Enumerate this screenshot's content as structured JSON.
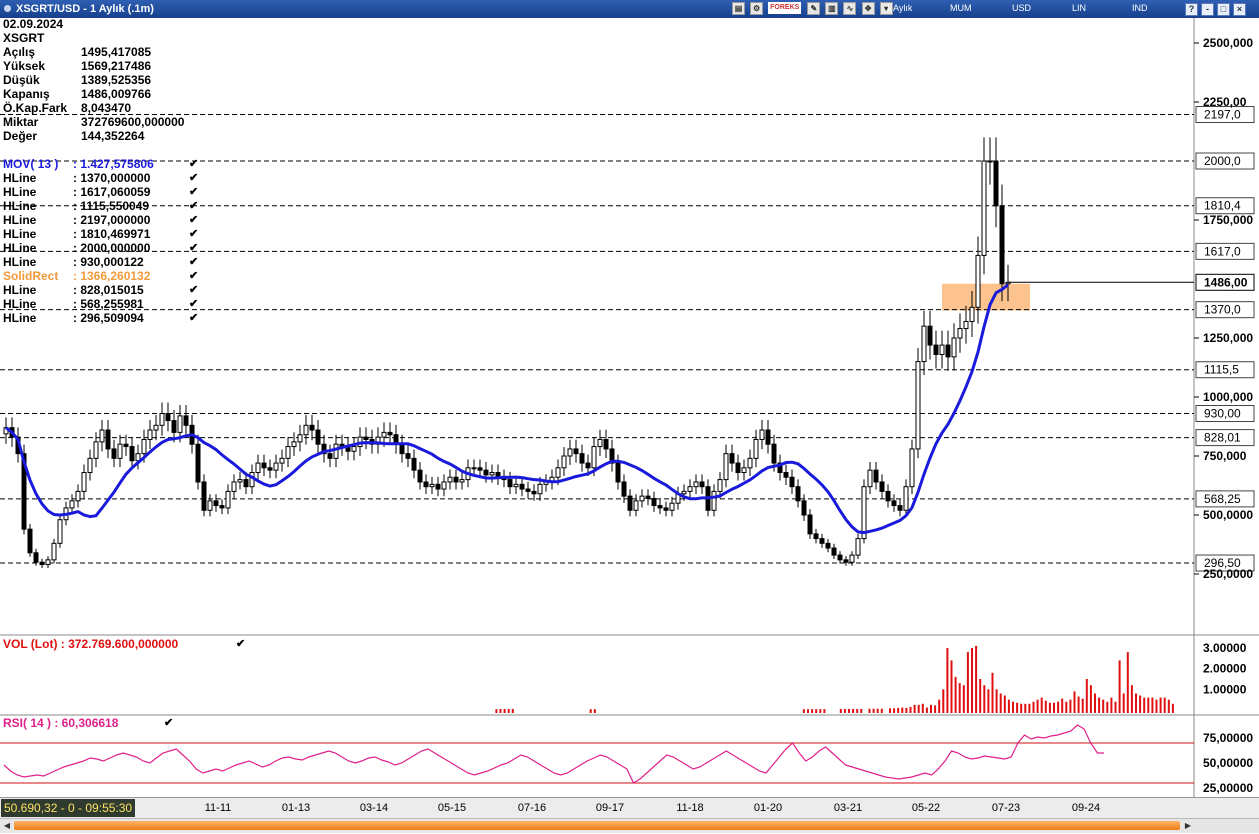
{
  "window": {
    "title": "XSGRT/USD - 1 Aylık (.1m)",
    "brand": "FOREKS",
    "options": [
      "1 Aylık",
      "MUM",
      "USD",
      "LIN",
      "IND"
    ],
    "controls": [
      "?",
      "-",
      "□",
      "×"
    ]
  },
  "info": {
    "date": "02.09.2024",
    "symbol": "XSGRT",
    "rows": [
      {
        "label": "Açılış",
        "value": "1495,417085"
      },
      {
        "label": "Yüksek",
        "value": "1569,217486"
      },
      {
        "label": "Düşük",
        "value": "1389,525356"
      },
      {
        "label": "Kapanış",
        "value": "1486,009766"
      },
      {
        "label": "Ö.Kap.Fark",
        "value": "8,043470"
      },
      {
        "label": "Miktar",
        "value": "372769600,000000"
      },
      {
        "label": "Değer",
        "value": "144,352264"
      }
    ]
  },
  "indicators": [
    {
      "name": "MOV( 13 )",
      "value": ": 1.427,575806",
      "color": "#1a1adc"
    },
    {
      "name": "HLine",
      "value": ": 1370,000000",
      "color": "#000000"
    },
    {
      "name": "HLine",
      "value": ": 1617,060059",
      "color": "#000000"
    },
    {
      "name": "HLine",
      "value": ": 1115,550049",
      "color": "#000000"
    },
    {
      "name": "HLine",
      "value": ": 2197,000000",
      "color": "#000000"
    },
    {
      "name": "HLine",
      "value": ": 1810,469971",
      "color": "#000000"
    },
    {
      "name": "HLine",
      "value": ": 2000,000000",
      "color": "#000000"
    },
    {
      "name": "HLine",
      "value": ": 930,000122",
      "color": "#000000"
    },
    {
      "name": "SolidRect",
      "value": ": 1366,260132",
      "color": "#f39a3a"
    },
    {
      "name": "HLine",
      "value": ": 828,015015",
      "color": "#000000"
    },
    {
      "name": "HLine",
      "value": ": 568,255981",
      "color": "#000000"
    },
    {
      "name": "HLine",
      "value": ": 296,509094",
      "color": "#000000"
    }
  ],
  "volume_label": "VOL (Lot)   : 372.769.600,000000",
  "rsi_label": "RSI( 14 )   : 60,306618",
  "status": {
    "clock": "50.690,32 - 0 - 09:55:30",
    "x_ticks": [
      "11-11",
      "01-13",
      "03-14",
      "05-15",
      "07-16",
      "09-17",
      "11-18",
      "01-20",
      "03-21",
      "05-22",
      "07-23",
      "09-24"
    ]
  },
  "chart_data": {
    "type": "candlestick",
    "price_axis": {
      "ticks": [
        "2500,000",
        "2250,00",
        "1750,000",
        "1250,000",
        "1000,000",
        "750,000",
        "500,0000",
        "250,0000"
      ],
      "tick_values": [
        2500,
        2250,
        1750,
        1250,
        1000,
        750,
        500,
        250
      ]
    },
    "hlines": [
      {
        "value": 2197.0,
        "label": "2197,0"
      },
      {
        "value": 2000.0,
        "label": "2000,0"
      },
      {
        "value": 1810.47,
        "label": "1810,4"
      },
      {
        "value": 1617.06,
        "label": "1617,0"
      },
      {
        "value": 1370.0,
        "label": "1370,0"
      },
      {
        "value": 1115.55,
        "label": "1115,5"
      },
      {
        "value": 930.0,
        "label": "930,00"
      },
      {
        "value": 828.02,
        "label": "828,01"
      },
      {
        "value": 568.26,
        "label": "568,25"
      },
      {
        "value": 296.51,
        "label": "296,50"
      }
    ],
    "last_price": {
      "value": 1486.01,
      "label": "1486,00"
    },
    "solid_rect": {
      "low": 1366.26,
      "high": 1480,
      "color": "#fbb97a"
    },
    "closes": [
      870,
      830,
      760,
      440,
      340,
      300,
      290,
      310,
      380,
      480,
      530,
      560,
      600,
      680,
      740,
      810,
      860,
      780,
      740,
      800,
      790,
      730,
      760,
      820,
      860,
      880,
      930,
      900,
      850,
      920,
      880,
      800,
      640,
      520,
      560,
      540,
      530,
      600,
      640,
      650,
      620,
      680,
      720,
      700,
      690,
      720,
      740,
      790,
      810,
      840,
      880,
      860,
      800,
      760,
      740,
      800,
      790,
      770,
      790,
      830,
      820,
      800,
      830,
      850,
      840,
      800,
      760,
      740,
      690,
      640,
      620,
      630,
      610,
      640,
      660,
      640,
      650,
      700,
      700,
      690,
      670,
      680,
      660,
      650,
      620,
      630,
      610,
      600,
      590,
      630,
      640,
      660,
      700,
      750,
      780,
      760,
      720,
      700,
      790,
      820,
      780,
      720,
      640,
      580,
      520,
      560,
      580,
      570,
      540,
      530,
      520,
      550,
      590,
      600,
      620,
      640,
      620,
      520,
      600,
      650,
      760,
      720,
      680,
      700,
      740,
      820,
      860,
      800,
      720,
      680,
      660,
      620,
      560,
      500,
      420,
      400,
      380,
      360,
      330,
      310,
      300,
      330,
      400,
      620,
      690,
      640,
      600,
      560,
      540,
      520,
      620,
      780,
      1150,
      1300,
      1220,
      1180,
      1220,
      1170,
      1250,
      1290,
      1320,
      1380,
      1600,
      2000,
      2000,
      1810,
      1480,
      1486
    ],
    "volume_axis": {
      "ticks": [
        "3.00000",
        "2.00000",
        "1.00000"
      ],
      "tick_values": [
        3.0,
        2.0,
        1.0
      ],
      "color": "#e01010"
    },
    "volumes": [
      0,
      0,
      0,
      0,
      0,
      0,
      0,
      0,
      0,
      0,
      0,
      0,
      0,
      0,
      0,
      0,
      0,
      0,
      0,
      0,
      0,
      0,
      0,
      0,
      0,
      0,
      0,
      0,
      0,
      0,
      0,
      0,
      0,
      0,
      0.04,
      0.05,
      0.05,
      0.05,
      0.05,
      0,
      0,
      0,
      0,
      0,
      0,
      0,
      0,
      0,
      0,
      0,
      0,
      0,
      0,
      0,
      0,
      0,
      0,
      0.04,
      0.04,
      0,
      0,
      0,
      0,
      0,
      0,
      0,
      0,
      0,
      0,
      0,
      0,
      0,
      0,
      0,
      0,
      0,
      0,
      0,
      0,
      0,
      0,
      0,
      0,
      0,
      0,
      0,
      0,
      0,
      0,
      0,
      0,
      0,
      0,
      0,
      0,
      0,
      0,
      0,
      0,
      0,
      0,
      0,
      0,
      0,
      0,
      0,
      0,
      0,
      0,
      0.04,
      0.04,
      0.04,
      0.04,
      0.04,
      0.04,
      0,
      0,
      0,
      0.05,
      0.05,
      0.05,
      0.05,
      0.05,
      0.05,
      0,
      0.06,
      0.06,
      0.06,
      0.06,
      0,
      0.08,
      0.08,
      0.1,
      0.12,
      0.1,
      0.15,
      0.25,
      0.25,
      0.3,
      0.12,
      0.25,
      0.22,
      0.5,
      1.0,
      3.0,
      2.4,
      1.6,
      1.3,
      1.2,
      2.8,
      3.0,
      3.1,
      1.5,
      1.2,
      1.0,
      1.8,
      1.0,
      0.8,
      0.7,
      0.5,
      0.4,
      0.35,
      0.3,
      0.3,
      0.3,
      0.4,
      0.5,
      0.6,
      0.45,
      0.35,
      0.35,
      0.4,
      0.55,
      0.4,
      0.5,
      0.9,
      0.65,
      0.55,
      1.5,
      1.2,
      0.8,
      0.6,
      0.5,
      0.4,
      0.6,
      0.4,
      2.4,
      0.8,
      2.8,
      1.2,
      0.8,
      0.7,
      0.6,
      0.6,
      0.6,
      0.5,
      0.6,
      0.6,
      0.5,
      0.3
    ],
    "rsi_axis": {
      "ticks": [
        "75,00000",
        "50,00000",
        "25,00000"
      ],
      "tick_values": [
        75,
        50,
        25
      ],
      "upper_band": 70,
      "lower_band": 30,
      "color": "#e0208a"
    },
    "rsi": [
      48,
      42,
      38,
      36,
      37,
      38,
      37,
      40,
      43,
      46,
      48,
      50,
      52,
      55,
      54,
      52,
      55,
      58,
      60,
      58,
      56,
      52,
      50,
      55,
      60,
      62,
      64,
      58,
      52,
      44,
      40,
      42,
      44,
      42,
      45,
      48,
      50,
      52,
      49,
      46,
      48,
      52,
      55,
      56,
      54,
      53,
      56,
      58,
      60,
      62,
      60,
      56,
      52,
      50,
      52,
      55,
      56,
      53,
      51,
      48,
      50,
      54,
      58,
      62,
      64,
      60,
      56,
      52,
      48,
      44,
      40,
      38,
      40,
      42,
      45,
      48,
      50,
      54,
      58,
      56,
      52,
      48,
      44,
      40,
      38,
      40,
      44,
      48,
      52,
      55,
      58,
      56,
      52,
      48,
      44,
      30,
      34,
      40,
      46,
      52,
      58,
      56,
      52,
      48,
      44,
      46,
      50,
      54,
      58,
      62,
      58,
      54,
      50,
      46,
      42,
      40,
      48,
      56,
      64,
      70,
      60,
      52,
      56,
      62,
      66,
      60,
      54,
      48,
      46,
      44,
      42,
      40,
      38,
      36,
      35,
      34,
      35,
      36,
      38,
      40,
      38,
      44,
      52,
      62,
      60,
      56,
      54,
      55,
      57,
      56,
      55,
      54,
      56,
      70,
      78,
      74,
      76,
      75,
      77,
      78,
      80,
      82,
      88,
      84,
      70,
      60,
      60
    ]
  }
}
